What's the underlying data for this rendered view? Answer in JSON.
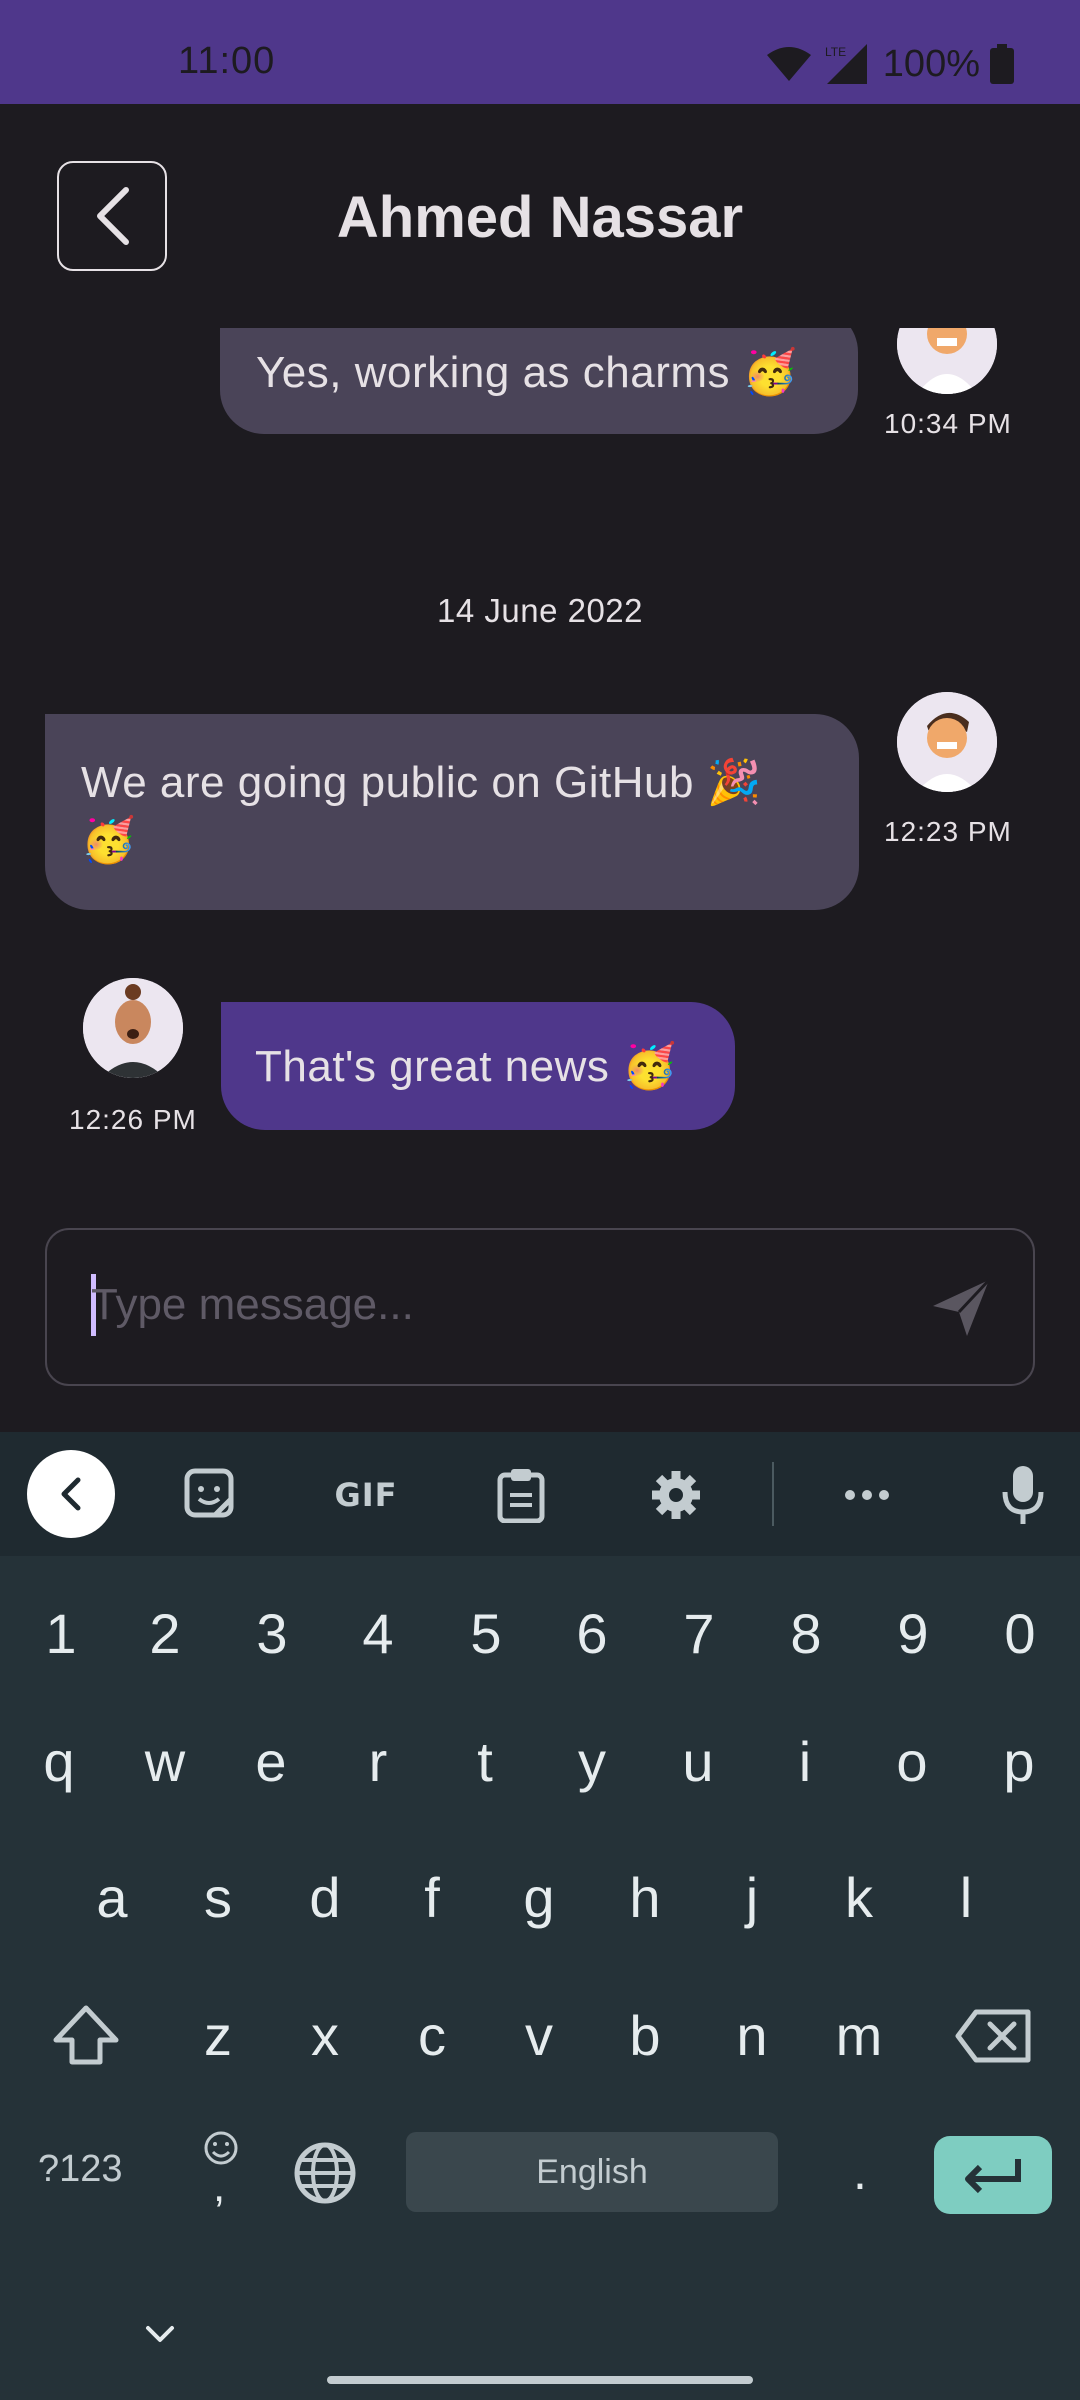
{
  "status_bar": {
    "time": "11:00",
    "battery_text": "100%",
    "network": "LTE"
  },
  "app_bar": {
    "title": "Ahmed Nassar"
  },
  "messages": [
    {
      "text": "Yes, working as charms 🥳",
      "time": "10:34 PM",
      "side": "right"
    },
    {
      "text": "We are going public on GitHub 🎉 🥳",
      "time": "12:23 PM",
      "side": "right"
    },
    {
      "text": "That's great news 🥳",
      "time": "12:26 PM",
      "side": "left"
    }
  ],
  "date_separator": "14 June 2022",
  "input": {
    "placeholder": "Type message...",
    "value": ""
  },
  "keyboard": {
    "toolbar": {
      "gif_label": "GIF"
    },
    "row_numbers": [
      "1",
      "2",
      "3",
      "4",
      "5",
      "6",
      "7",
      "8",
      "9",
      "0"
    ],
    "row1": [
      "q",
      "w",
      "e",
      "r",
      "t",
      "y",
      "u",
      "i",
      "o",
      "p"
    ],
    "row2": [
      "a",
      "s",
      "d",
      "f",
      "g",
      "h",
      "j",
      "k",
      "l"
    ],
    "row3": [
      "z",
      "x",
      "c",
      "v",
      "b",
      "n",
      "m"
    ],
    "symbols_label": "?123",
    "comma_label": ",",
    "space_label": "English",
    "period_label": "."
  },
  "colors": {
    "status_bar": "#4f378b",
    "background": "#1d1b20",
    "incoming_bubble": "#4a4458",
    "outgoing_bubble": "#4f378b",
    "keyboard_bg": "#253238",
    "enter_key": "#7ecdc1"
  }
}
